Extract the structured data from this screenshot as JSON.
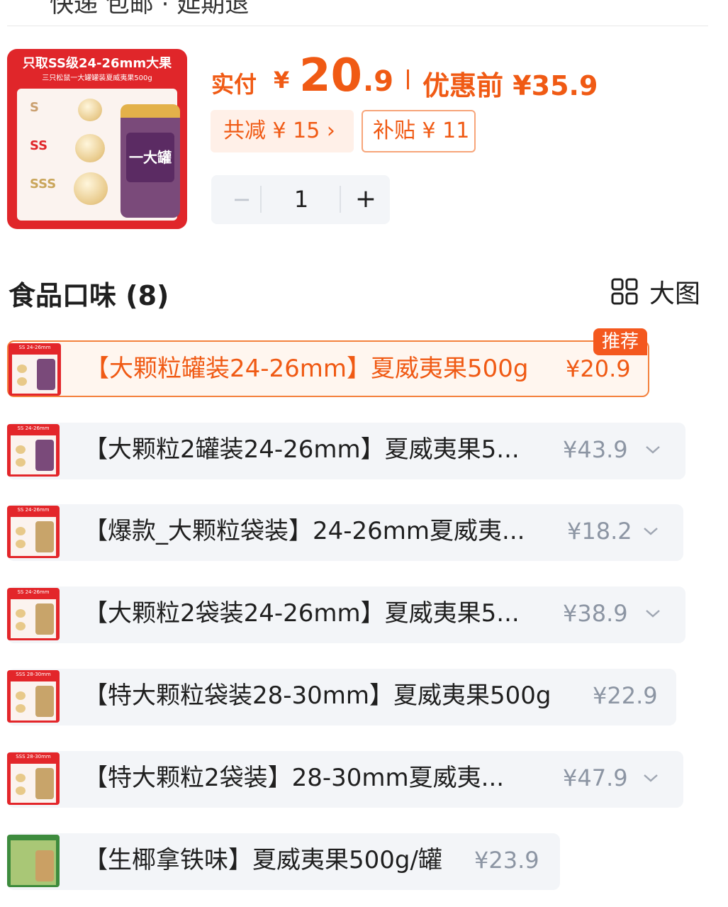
{
  "header": {
    "cut_text": "快递 包邮 · 延期退",
    "price_label": "实付",
    "currency": "¥",
    "price_int": "20",
    "price_dec": ".9",
    "old_price": "优惠前 ¥35.9"
  },
  "product_image": {
    "banner": "只取SS级24-26mm大果",
    "sub": "三只松鼠一大罐罐装夏威夷果500g",
    "grades": [
      "S",
      "SS",
      "SSS"
    ],
    "jar_text": "一大罐"
  },
  "tags": {
    "discount": "共减 ¥ 15 ›",
    "subsidy": "补贴 ¥ 11"
  },
  "stepper": {
    "minus": "−",
    "quantity": "1",
    "plus": "+"
  },
  "section": {
    "title": "食品口味 (8)",
    "view_label": "大图"
  },
  "badge": "推荐",
  "options": [
    {
      "label": "【大颗粒罐装24-26mm】夏威夷果500g",
      "price": "¥20.9"
    },
    {
      "label": "【大颗粒2罐装24-26mm】夏威夷果5...",
      "price": "¥43.9"
    },
    {
      "label": "【爆款_大颗粒袋装】24-26mm夏威夷...",
      "price": "¥18.2"
    },
    {
      "label": "【大颗粒2袋装24-26mm】夏威夷果5...",
      "price": "¥38.9"
    },
    {
      "label": "【特大颗粒袋装28-30mm】夏威夷果500g",
      "price": "¥22.9"
    },
    {
      "label": "【特大颗粒2袋装】28-30mm夏威夷...",
      "price": "¥47.9"
    },
    {
      "label": "【生椰拿铁味】夏威夷果500g/罐",
      "price": "¥23.9"
    }
  ],
  "colors": {
    "accent": "#f05a14",
    "option_bg": "#f3f5f8",
    "selected_border": "#f4813d"
  }
}
